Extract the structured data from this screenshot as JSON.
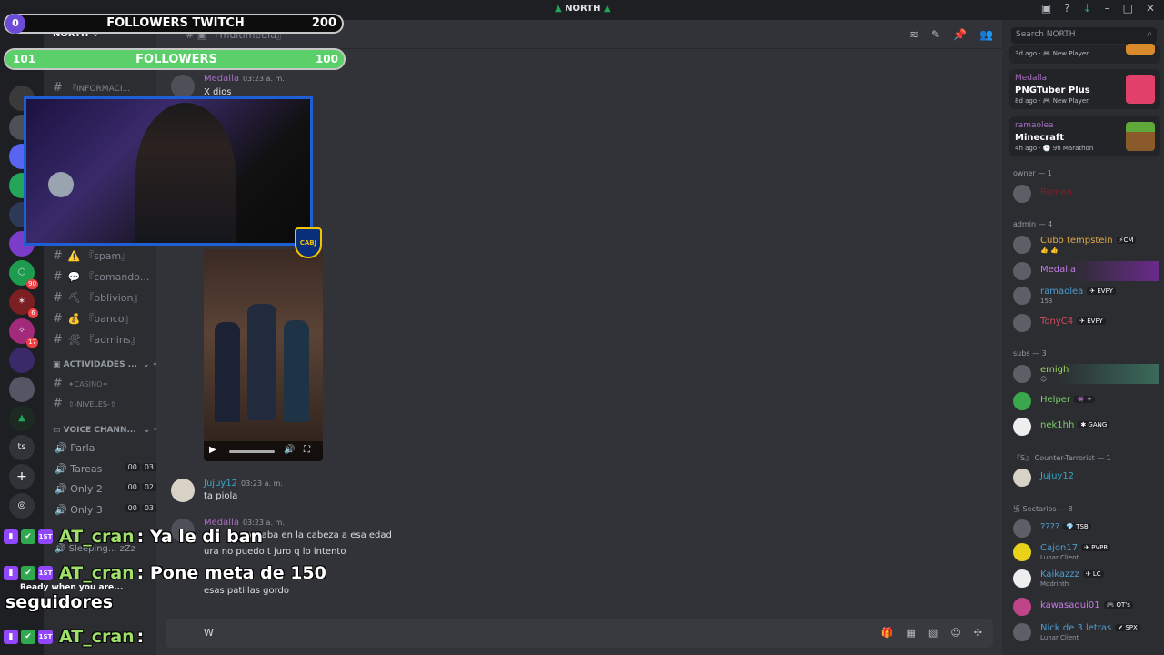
{
  "window": {
    "title": "NORTH",
    "controls": [
      "–",
      "□",
      "✕"
    ]
  },
  "servers": [
    {
      "label": "ts",
      "badge": ""
    },
    {
      "label": "⬡",
      "badge": "90"
    },
    {
      "label": "✶",
      "badge": "6"
    },
    {
      "label": "✧",
      "badge": "17"
    },
    {
      "label": "+",
      "badge": ""
    }
  ],
  "channels": {
    "server_name": "NORTH ⌄",
    "items": [
      {
        "name": "『INFORMACI..."
      },
      {
        "name": "⚠️ 『spam』"
      },
      {
        "name": "💬 『comando..."
      },
      {
        "name": "⛏ 『oblivion』"
      },
      {
        "name": "💰 『banco』"
      },
      {
        "name": "🛠 『admins』"
      }
    ],
    "cat_actividades": "ACTIVIDADES ...",
    "act_items": [
      "✦CASINO✦",
      "⇧-NIVELES-⇧"
    ],
    "cat_voice": "VOICE CHANN...",
    "voice": [
      {
        "name": "Parla",
        "a": "",
        "b": ""
      },
      {
        "name": "Tareas",
        "a": "00",
        "b": "03"
      },
      {
        "name": "Only 2",
        "a": "00",
        "b": "02"
      },
      {
        "name": "Only 3",
        "a": "00",
        "b": "03"
      },
      {
        "name": "Sleeping... zZz",
        "a": "",
        "b": ""
      }
    ],
    "header_channel": "『multimedia』"
  },
  "messages": [
    {
      "author": "Medalla",
      "time": "03:23 a. m.",
      "text": "X dios",
      "color": "#a96dc2"
    },
    {
      "author": "Jujuy12",
      "time": "03:23 a. m.",
      "text": "ta piola",
      "color": "#3aa7c4"
    },
    {
      "author": "Medalla",
      "time": "03:23 a. m.",
      "text": "pasaba en la cabeza a esa edad",
      "color": "#a96dc2"
    },
    {
      "text2": "ura no puedo t juro q lo intento"
    },
    {
      "text3": "esas patillas gordo"
    }
  ],
  "composer": {
    "value": "W"
  },
  "members": {
    "search_placeholder": "Search NORTH",
    "activities": [
      {
        "who": "",
        "game": "",
        "meta": "3d ago · 🎮 New Player"
      },
      {
        "who": "Medalla",
        "game": "PNGTuber Plus",
        "meta": "8d ago · 🎮 New Player"
      },
      {
        "who": "ramaolea",
        "game": "Minecraft",
        "meta": "4h ago · 🕒 9h Marathon"
      }
    ],
    "roles": [
      {
        "header": "owner — 1",
        "list": [
          {
            "name": "Roman",
            "color": "#7d1f2a",
            "tag": "",
            "sub": ""
          }
        ]
      },
      {
        "header": "admin — 4",
        "list": [
          {
            "name": "Cubo tempstein",
            "color": "#e0a94a",
            "tag": "⚡CM",
            "sub": "👍 👍"
          },
          {
            "name": "Medalla",
            "color": "#c77be6",
            "tag": "",
            "sub": ""
          },
          {
            "name": "ramaolea",
            "color": "#4f9ccf",
            "tag": "✈ EVFY",
            "sub": "153"
          },
          {
            "name": "TonyC4",
            "color": "#d44b5d",
            "tag": "✈ EVFY",
            "sub": ""
          }
        ]
      },
      {
        "header": "subs — 3",
        "list": [
          {
            "name": "emigh",
            "color": "#9fd65f",
            "tag": "",
            "sub": "😊"
          },
          {
            "name": "Helper",
            "color": "#7fcf6a",
            "tag": "👾 ✧",
            "sub": ""
          },
          {
            "name": "nek1hh",
            "color": "#7fcf6a",
            "tag": "✱ GANG",
            "sub": ""
          }
        ]
      },
      {
        "header": "『S』 Counter-Terrorist — 1",
        "list": [
          {
            "name": "Jujuy12",
            "color": "#3aa7c4",
            "tag": "",
            "sub": ""
          }
        ]
      },
      {
        "header": "卐 Sectarios — 8",
        "list": [
          {
            "name": "????",
            "color": "#4f9ccf",
            "tag": "💎 TSB",
            "sub": ""
          },
          {
            "name": "Cajon17",
            "color": "#4f9ccf",
            "tag": "✈ PVPR",
            "sub": "Lunar Client"
          },
          {
            "name": "Kaikazzz",
            "color": "#4f9ccf",
            "tag": "✈ LC",
            "sub": "Modrinth"
          },
          {
            "name": "kawasaqui01",
            "color": "#c77be6",
            "tag": "🎮 OT's",
            "sub": ""
          },
          {
            "name": "Nick de 3 letras",
            "color": "#4f9ccf",
            "tag": "✔ SPX",
            "sub": "Lunar Client"
          }
        ]
      }
    ]
  },
  "overlay": {
    "followers_bar": {
      "left": "0",
      "title": "FOLLOWERS TWITCH",
      "right": "200"
    },
    "followers_bar2": {
      "left": "101",
      "title": "FOLLOWERS",
      "right": "100",
      "progress": 1.0
    },
    "crest_text": "CABJ",
    "chat": [
      {
        "user": "AT_cran",
        "text": ": Ya le di ban"
      },
      {
        "user": "AT_cran",
        "text": ": Pone meta de 150"
      },
      {
        "user": "AT_cran",
        "text": ":"
      }
    ],
    "wrap_text": "seguidores",
    "ready_text": "Ready when you are..."
  }
}
